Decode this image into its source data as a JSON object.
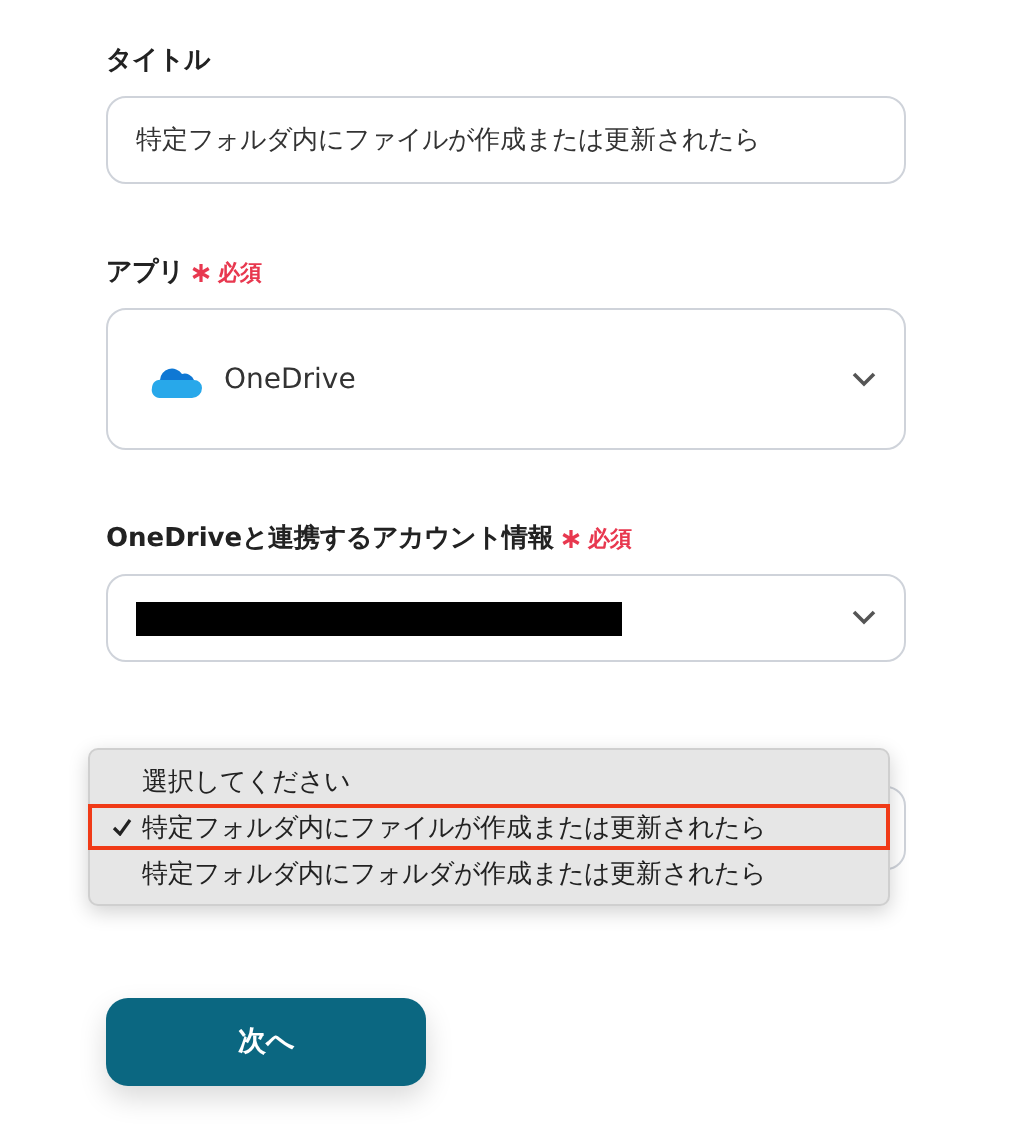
{
  "title_field": {
    "label": "タイトル",
    "value": "特定フォルダ内にファイルが作成または更新されたら"
  },
  "app_field": {
    "label": "アプリ",
    "required": "必須",
    "value": "OneDrive"
  },
  "account_field": {
    "label": "OneDriveと連携するアカウント情報",
    "required": "必須",
    "redacted": true
  },
  "trigger_field": {
    "options": [
      {
        "label": "選択してください",
        "selected": false
      },
      {
        "label": "特定フォルダ内にファイルが作成または更新されたら",
        "selected": true
      },
      {
        "label": "特定フォルダ内にフォルダが作成または更新されたら",
        "selected": false
      }
    ]
  },
  "next_button": {
    "label": "次へ"
  }
}
